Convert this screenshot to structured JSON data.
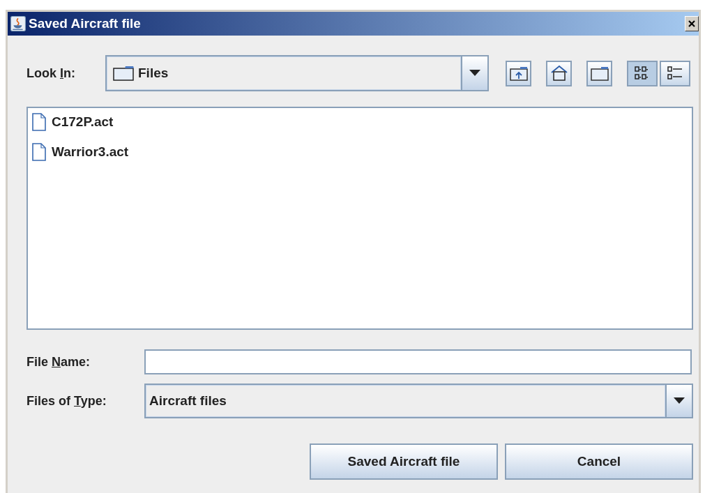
{
  "window": {
    "title": "Saved Aircraft file"
  },
  "look_in": {
    "label": {
      "before": "Look ",
      "key": "I",
      "after": "n:"
    },
    "value": "Files"
  },
  "toolbar": [
    {
      "kind": "up",
      "selected": false
    },
    {
      "kind": "home",
      "selected": false
    },
    {
      "kind": "new-folder",
      "selected": false
    },
    {
      "kind": "list",
      "selected": true
    },
    {
      "kind": "details",
      "selected": false
    }
  ],
  "files": [
    {
      "name": "C172P.act",
      "selected": false
    },
    {
      "name": "Warrior3.act",
      "selected": false
    }
  ],
  "file_name": {
    "label": {
      "before": "File ",
      "key": "N",
      "after": "ame:"
    }
  },
  "file_type": {
    "label": {
      "before": "Files of ",
      "key": "T",
      "after": "ype:"
    },
    "value": "Aircraft files"
  },
  "buttons": [
    "Saved Aircraft file",
    "Cancel"
  ]
}
